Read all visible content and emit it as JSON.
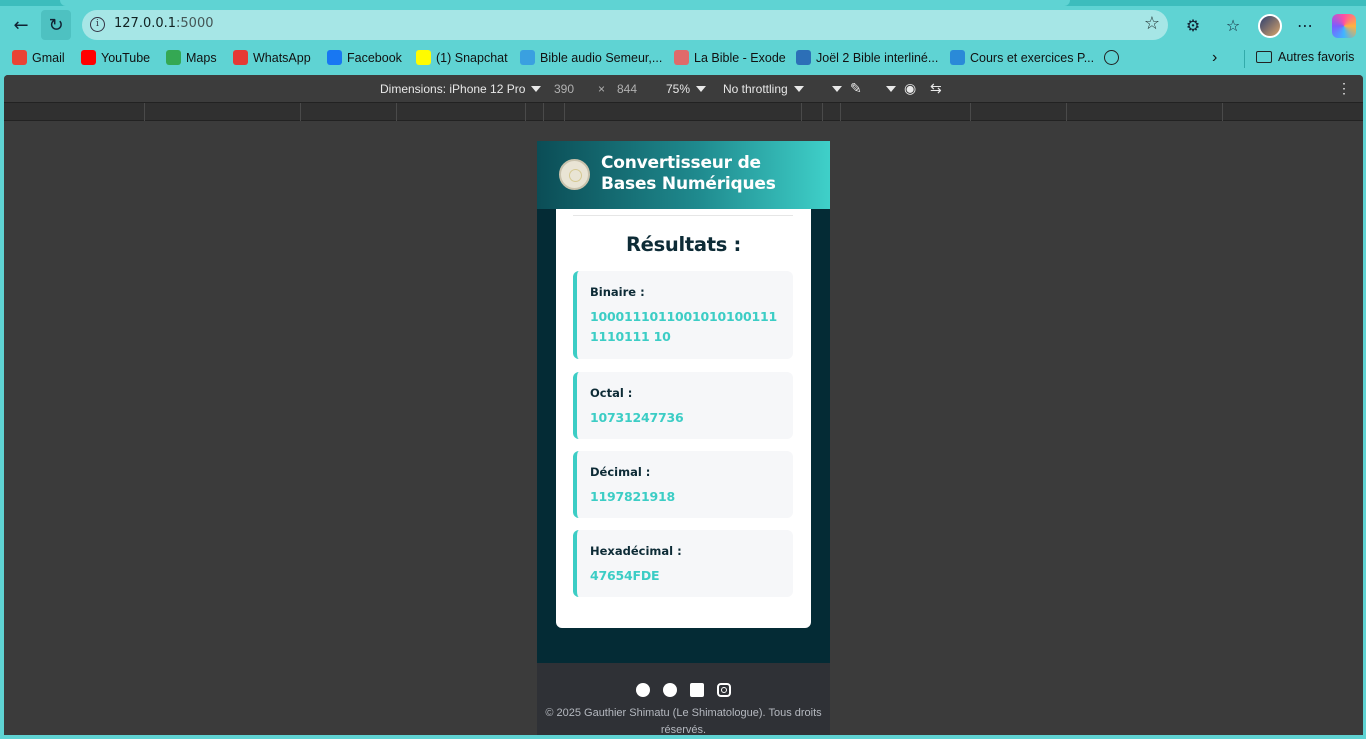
{
  "browser": {
    "url_host": "127.0.0.1",
    "url_port": ":5000",
    "bookmarks": [
      {
        "label": "Gmail",
        "icon": "gmail-icon",
        "color": "#ea4335"
      },
      {
        "label": "YouTube",
        "icon": "youtube-icon",
        "color": "#ff0000"
      },
      {
        "label": "Maps",
        "icon": "maps-icon",
        "color": "#34a853"
      },
      {
        "label": "WhatsApp",
        "icon": "whatsapp-icon",
        "color": "#e53935"
      },
      {
        "label": "Facebook",
        "icon": "facebook-icon",
        "color": "#1877f2"
      },
      {
        "label": "(1) Snapchat",
        "icon": "snapchat-icon",
        "color": "#fffc00"
      },
      {
        "label": "Bible audio Semeur,...",
        "icon": "bible-audio-icon",
        "color": "#3aa0e0"
      },
      {
        "label": "La Bible - Exode",
        "icon": "bible-exode-icon",
        "color": "#e06a6a"
      },
      {
        "label": "Joël 2 Bible interliné...",
        "icon": "interlinear-bible-icon",
        "color": "#2c6fb7"
      },
      {
        "label": "Cours et exercices P...",
        "icon": "courses-icon",
        "color": "#2a8ad8"
      },
      {
        "label": "",
        "icon": "globe-icon",
        "color": "#222222"
      }
    ],
    "other_bookmarks": "Autres favoris"
  },
  "devtools": {
    "dimensions_label": "Dimensions: iPhone 12 Pro",
    "width": "390",
    "times": "×",
    "height": "844",
    "zoom": "75%",
    "throttling": "No throttling"
  },
  "app": {
    "title": "Convertisseur de Bases Numériques",
    "results_title": "Résultats :",
    "results": [
      {
        "label": "Binaire :",
        "value": "10001110110010101001111110111 10"
      },
      {
        "label": "Octal :",
        "value": "10731247736"
      },
      {
        "label": "Décimal :",
        "value": "1197821918"
      },
      {
        "label": "Hexadécimal :",
        "value": "47654FDE"
      }
    ],
    "footer": {
      "socials": [
        "github-icon",
        "facebook-icon",
        "linkedin-icon",
        "instagram-icon"
      ],
      "copyright": "© 2025 Gauthier Shimatu (Le Shimatologue). Tous droits réservés."
    },
    "accent_color": "#3ccdc5"
  }
}
